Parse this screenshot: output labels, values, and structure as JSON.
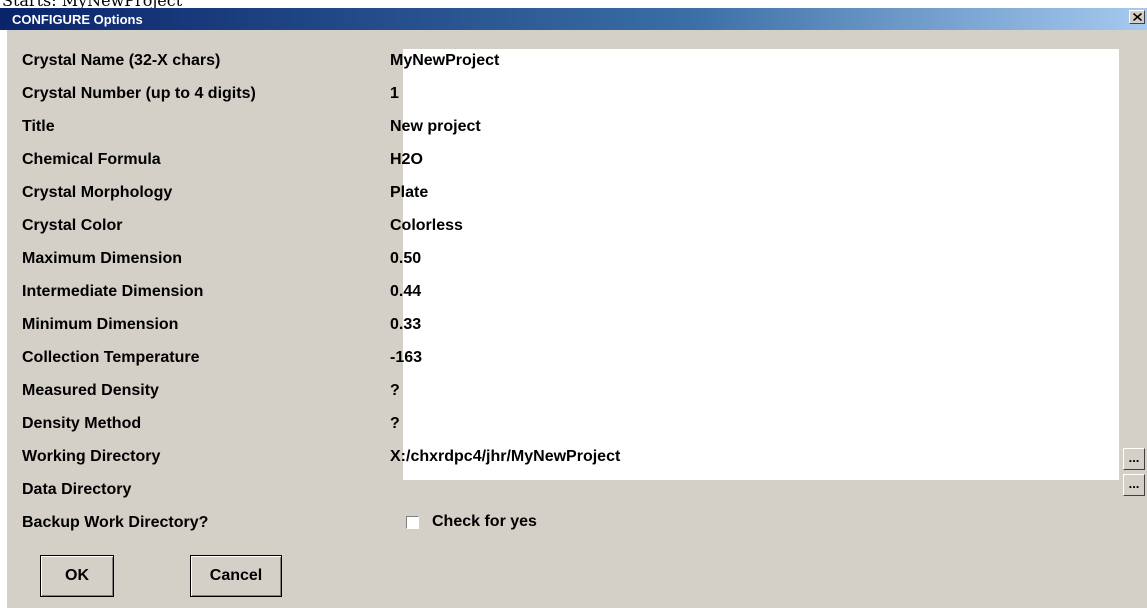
{
  "background_window": {
    "title_fragment": "Starts: MyNewProject"
  },
  "dialog": {
    "title": "CONFIGURE Options",
    "close_glyph": "×"
  },
  "fields": [
    {
      "label": "Crystal Name   (32-X chars)",
      "value": "MyNewProject"
    },
    {
      "label": "Crystal Number (up to 4 digits)",
      "value": "1"
    },
    {
      "label": "Title",
      "value": "New project"
    },
    {
      "label": "Chemical Formula",
      "value": "H2O"
    },
    {
      "label": "Crystal Morphology",
      "value": "Plate"
    },
    {
      "label": "Crystal Color",
      "value": "Colorless"
    },
    {
      "label": "Maximum Dimension",
      "value": "0.50"
    },
    {
      "label": "Intermediate Dimension",
      "value": "0.44"
    },
    {
      "label": "Minimum Dimension",
      "value": "0.33"
    },
    {
      "label": "Collection Temperature",
      "value": "-163"
    },
    {
      "label": "Measured Density",
      "value": "?"
    },
    {
      "label": "Density Method",
      "value": "?"
    },
    {
      "label": "Working Directory",
      "value": "X:/chxrdpc4/jhr/MyNewProject"
    },
    {
      "label": "Data Directory",
      "value": ""
    }
  ],
  "browse_buttons": {
    "working_directory_label": "...",
    "data_directory_label": "..."
  },
  "backup": {
    "label": "Backup Work Directory?",
    "checkbox_label": "Check for yes",
    "checked": false
  },
  "buttons": {
    "ok_label": "OK",
    "cancel_label": "Cancel"
  },
  "colors": {
    "title_bar_start": "#0a246a",
    "title_bar_end": "#a6caf0",
    "dialog_background": "#d4d0c8",
    "value_panel": "#ffffff"
  }
}
